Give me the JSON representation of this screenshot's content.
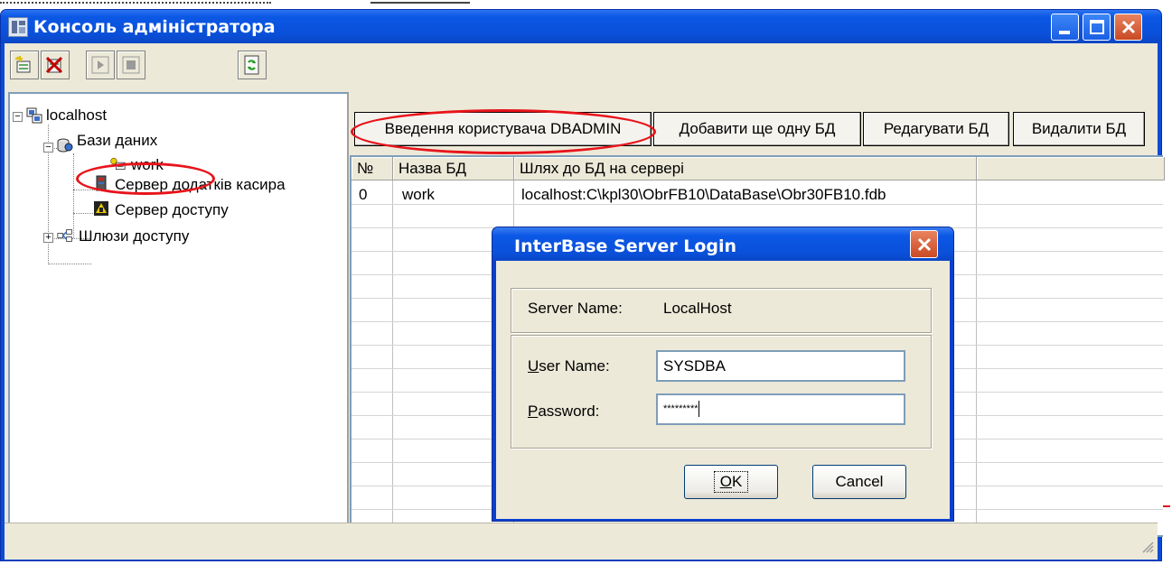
{
  "window": {
    "title": "Консоль адміністратора"
  },
  "tree": {
    "root": "localhost",
    "databases": "Бази даних",
    "db_work": "work",
    "cashier_server": "Сервер додатків касира",
    "access_server": "Сервер доступу",
    "gateways": "Шлюзи доступу"
  },
  "actions": {
    "enter_user": "Введення користувача DBADMIN",
    "add_db": "Добавити ще одну БД",
    "edit_db": "Редагувати БД",
    "delete_db": "Видалити БД"
  },
  "grid": {
    "columns": [
      "№",
      "Назва БД",
      "Шлях до БД на сервері"
    ],
    "rows": [
      {
        "num": "0",
        "name": "work",
        "path": "localhost:C\\kpl30\\ObrFB10\\DataBase\\Obr30FB10.fdb"
      }
    ]
  },
  "dialog": {
    "title": "InterBase Server Login",
    "server_label": "Server Name:",
    "server_value": "LocalHost",
    "user_label_u": "U",
    "user_label_rest": "ser Name:",
    "user_value": "SYSDBA",
    "password_label_u": "P",
    "password_label_rest": "assword:",
    "password_value": "*********",
    "ok_u": "O",
    "ok_rest": "K",
    "cancel": "Cancel"
  },
  "icons": {
    "title": "app-icon",
    "new": "add-icon",
    "delete": "delete-icon",
    "start": "start-icon",
    "stop": "stop-icon",
    "refresh": "refresh-icon"
  },
  "colors": {
    "titlebar": "#0a4fd8",
    "annotation": "#e8141a",
    "face": "#ece9d8"
  }
}
